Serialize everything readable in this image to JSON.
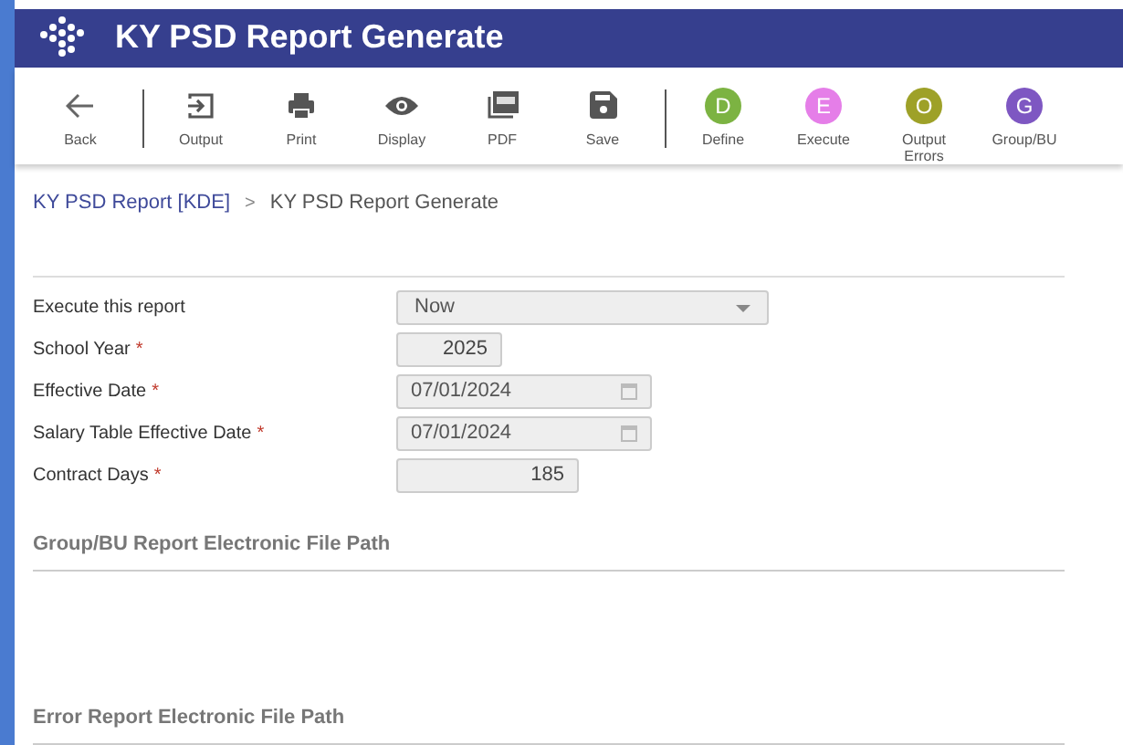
{
  "window": {
    "title": "KY PSD Report Generate"
  },
  "toolbar": [
    {
      "kind": "icon",
      "label": "Back",
      "separator_after": true
    },
    {
      "kind": "icon",
      "label": "Output",
      "separator_after": false
    },
    {
      "kind": "icon",
      "label": "Print",
      "separator_after": false
    },
    {
      "kind": "icon",
      "label": "Display",
      "separator_after": false
    },
    {
      "kind": "icon",
      "label": "PDF",
      "separator_after": false
    },
    {
      "kind": "icon",
      "label": "Save",
      "separator_after": true
    },
    {
      "kind": "letter",
      "letter": "D",
      "color": "#7cb342",
      "label": "Define",
      "separator_after": false
    },
    {
      "kind": "letter",
      "letter": "E",
      "color": "#e57ee8",
      "label": "Execute",
      "separator_after": false
    },
    {
      "kind": "letter",
      "letter": "O",
      "color": "#9ea128",
      "label": "Output Errors",
      "separator_after": false
    },
    {
      "kind": "letter",
      "letter": "G",
      "color": "#7e57c2",
      "label": "Group/BU",
      "separator_after": false
    }
  ],
  "breadcrumb": {
    "parent": "KY PSD Report [KDE]",
    "separator": ">",
    "current": "KY PSD Report Generate"
  },
  "fields": [
    {
      "kind": "select",
      "label": "Execute this report",
      "value": "Now"
    },
    {
      "kind": "number",
      "label": "School Year",
      "required_mark": "*",
      "value": "2025"
    },
    {
      "kind": "date",
      "label": "Effective Date",
      "required_mark": "*",
      "value": "07/01/2024"
    },
    {
      "kind": "date",
      "label": "Salary Table Effective Date",
      "required_mark": "*",
      "value": "07/01/2024"
    },
    {
      "kind": "days",
      "label": "Contract Days",
      "required_mark": "*",
      "value": "185"
    }
  ],
  "sections": [
    {
      "title": "Group/BU Report Electronic File Path"
    },
    {
      "title": "Error Report Electronic File Path"
    }
  ]
}
